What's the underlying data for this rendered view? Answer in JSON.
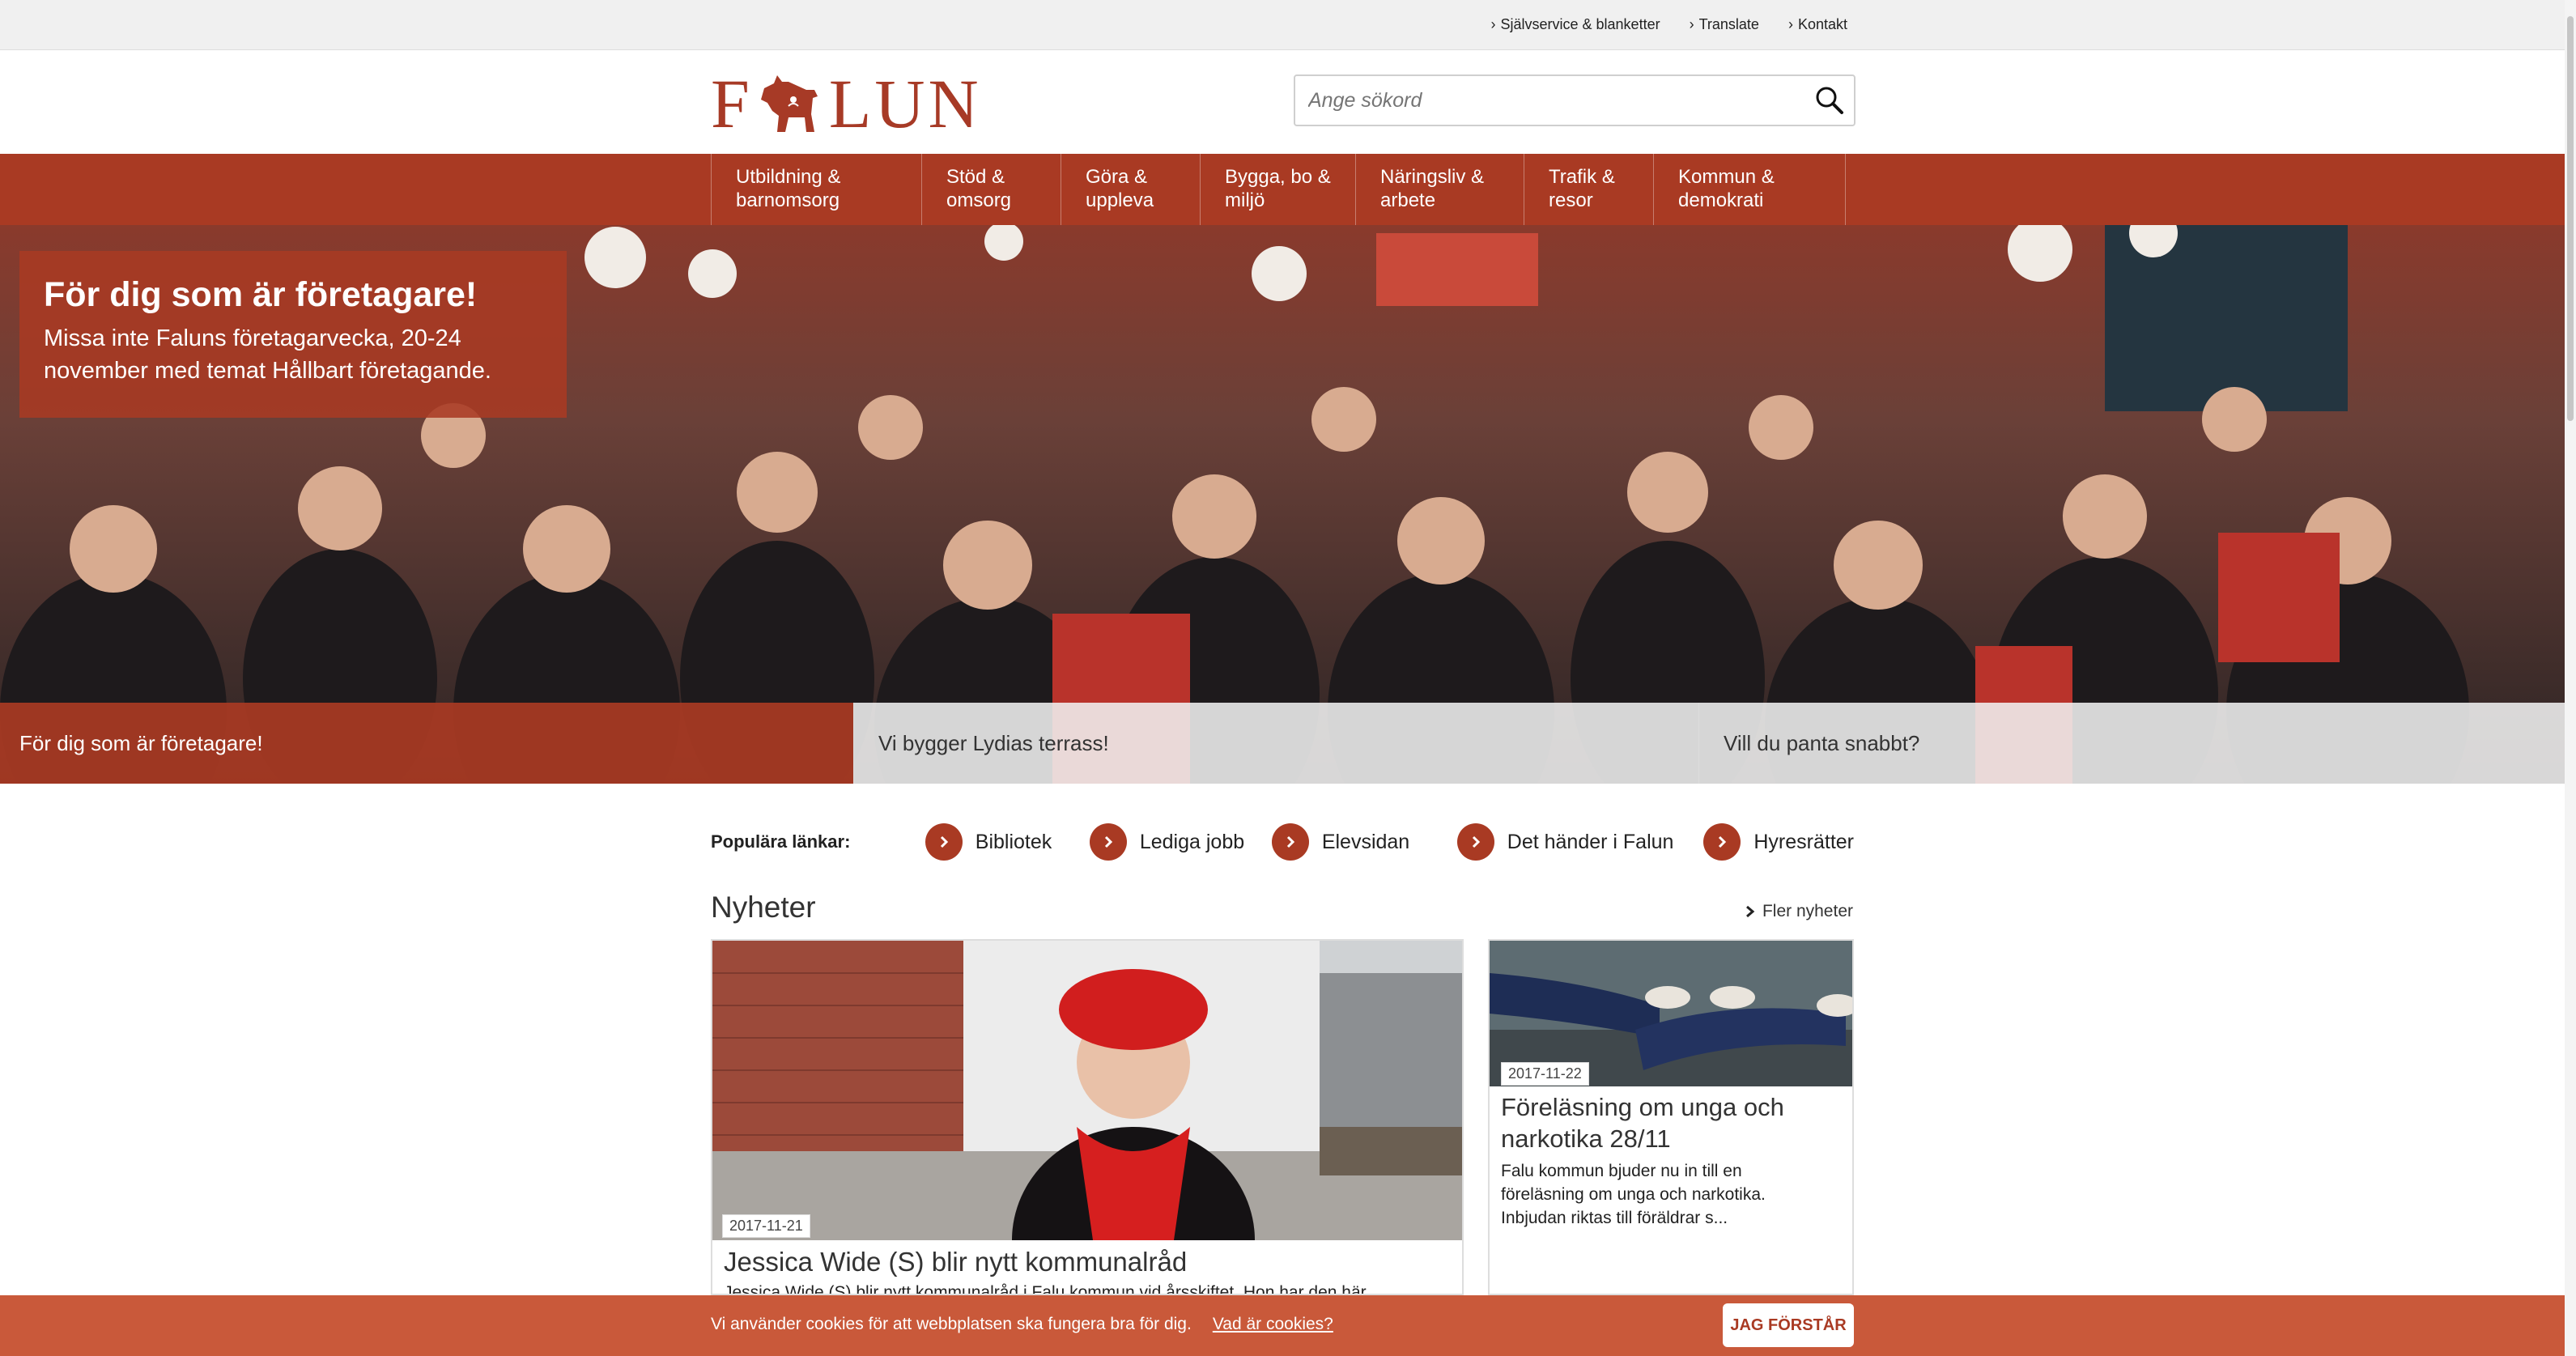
{
  "topbar": {
    "links": [
      {
        "label": "Självservice & blanketter",
        "icon": "chevron-right-icon"
      },
      {
        "label": "Translate",
        "icon": "chevron-right-icon"
      },
      {
        "label": "Kontakt",
        "icon": "chevron-right-icon"
      }
    ]
  },
  "header": {
    "logo_text_1": "F",
    "logo_text_2": "LUN",
    "logo_icon": "dala-horse-icon",
    "search_placeholder": "Ange sökord",
    "search_icon": "search-icon"
  },
  "nav": {
    "items": [
      {
        "line1": "Utbildning &",
        "line2": "barnomsorg"
      },
      {
        "line1": "Stöd &",
        "line2": "omsorg"
      },
      {
        "line1": "Göra &",
        "line2": "uppleva"
      },
      {
        "line1": "Bygga, bo &",
        "line2": "miljö"
      },
      {
        "line1": "Näringsliv &",
        "line2": "arbete"
      },
      {
        "line1": "Trafik &",
        "line2": "resor"
      },
      {
        "line1": "Kommun &",
        "line2": "demokrati"
      }
    ]
  },
  "hero": {
    "title": "För dig som är företagare!",
    "text": "Missa inte Faluns företagarvecka, 20-24 november med temat Hållbart företagande.",
    "tabs": [
      {
        "label": "För dig som är företagare!",
        "active": true
      },
      {
        "label": "Vi bygger Lydias terrass!",
        "active": false
      },
      {
        "label": "Vill du panta snabbt?",
        "active": false
      }
    ]
  },
  "popular": {
    "label": "Populära länkar:",
    "links": [
      "Bibliotek",
      "Lediga jobb",
      "Elevsidan",
      "Det händer i Falun",
      "Hyresrätter"
    ]
  },
  "news": {
    "title": "Nyheter",
    "more": "Fler nyheter",
    "items": [
      {
        "date": "2017-11-21",
        "title": "Jessica Wide (S) blir nytt kommunalråd",
        "excerpt": "Jessica Wide (S) blir nytt kommunalråd i Falu kommun vid årsskiftet. Hon har den här"
      },
      {
        "date": "2017-11-22",
        "title": "Föreläsning om unga och narkotika 28/11",
        "excerpt": "Falu kommun bjuder nu in till en föreläsning om unga och narkotika. Inbjudan riktas till föräldrar s..."
      }
    ]
  },
  "cookie": {
    "text": "Vi använder cookies för att webbplatsen ska fungera bra för dig.",
    "link": "Vad är cookies?",
    "button": "JAG FÖRSTÅR"
  },
  "colors": {
    "brand": "#a93a23",
    "cookie": "#c9593a"
  }
}
